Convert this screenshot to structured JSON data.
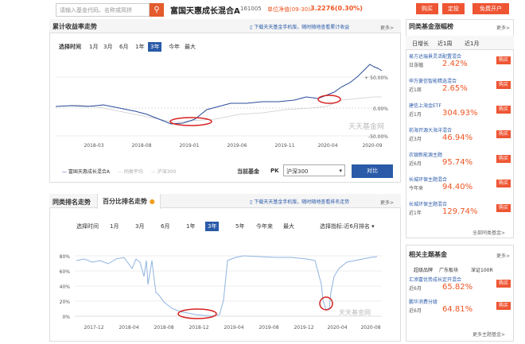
{
  "top": {
    "search_placeholder": "请输入基金代码、名称或简拼",
    "search_icon": "search-icon",
    "fund_name": "富国天惠成长混合A",
    "fund_code": "161005",
    "nav_label": "单位净值(09-30):",
    "nav_value": "3.2276(0.30%)",
    "buy": "购买",
    "fixed": "定投",
    "open_account": "免费开户"
  },
  "chart1": {
    "tab": "累计收益率走势",
    "notice": "下载天天基金手机版，随时随地查看累计收益",
    "more": "更多>",
    "time_label": "选择时间",
    "ranges": [
      "1月",
      "3月",
      "6月",
      "1年",
      "3年",
      "今年",
      "最大"
    ],
    "active_range": "3年",
    "y_ticks": [
      "+ 50.00%",
      "0.00%",
      "-50.00%"
    ],
    "x_ticks": [
      "2018-03",
      "2018-08",
      "2019-01",
      "2019-06",
      "2019-11",
      "2020-04",
      "2020-09"
    ],
    "watermark": "天天基金网",
    "legend": [
      "富国天惠成长混合A",
      "同类平均",
      "沪深300"
    ],
    "pk_label": "当前基金",
    "pk": "PK",
    "pk_select": "沪深300",
    "compare_button": "对比"
  },
  "chart2": {
    "tab1": "同类排名走势",
    "tab2": "百分比排名走势",
    "notice": "下载天天基金手机版，随时随地查看排名走势",
    "more": "更多>",
    "time_label": "选择时间",
    "ranges": [
      "1月",
      "3月",
      "6月",
      "1年",
      "3年",
      "5年",
      "今年来",
      "最大"
    ],
    "active_range": "3年",
    "indicator_label": "选择指标:",
    "indicator_value": "近6月排名",
    "y_ticks": [
      "80%",
      "60%",
      "40%",
      "20%",
      "0%"
    ],
    "x_ticks": [
      "2017-12",
      "2018-04",
      "2018-08",
      "2018-12",
      "2019-04",
      "2019-08",
      "2019-12",
      "2020-04",
      "2020-08"
    ],
    "watermark": "天天基金网"
  },
  "rank": {
    "title": "同类基金涨幅榜",
    "more": "更多>",
    "tabs": [
      "日增长",
      "近1周",
      "近1月"
    ],
    "items": [
      {
        "name": "易方达瑞景灵活配置混合",
        "period": "日涨幅",
        "value": "2.42%",
        "buy": "购买"
      },
      {
        "name": "申万菱信智能精选混合",
        "period": "近1周",
        "value": "2.65%",
        "buy": "购买"
      },
      {
        "name": "建信上海金ETF",
        "period": "近1月",
        "value": "304.93%",
        "buy": "购买"
      },
      {
        "name": "前海开源大海洋混合",
        "period": "近3月",
        "value": "46.94%",
        "buy": "购买"
      },
      {
        "name": "农银新能源主题",
        "period": "近6月",
        "value": "95.74%",
        "buy": "购买"
      },
      {
        "name": "长城环保主题混合",
        "period": "今年来",
        "value": "94.40%",
        "buy": "购买"
      },
      {
        "name": "长城环保主题混合",
        "period": "近1年",
        "value": "129.74%",
        "buy": "购买"
      }
    ],
    "footer": "全部同类基金>"
  },
  "theme": {
    "title": "相关主题基金",
    "more": "更多>",
    "tabs": [
      "超级品牌",
      "广东板块",
      "深证100R"
    ],
    "items": [
      {
        "name": "汇添富优势成长定开混合",
        "period": "近6月",
        "value": "65.82%",
        "buy": "购买"
      },
      {
        "name": "鹏华消费分级",
        "period": "近6月",
        "value": "64.81%",
        "buy": "购买"
      }
    ],
    "footer": "更多主题基金>"
  },
  "colors": {
    "accent": "#e45b2c",
    "blue": "#2a5aa8",
    "red": "#e52222"
  }
}
